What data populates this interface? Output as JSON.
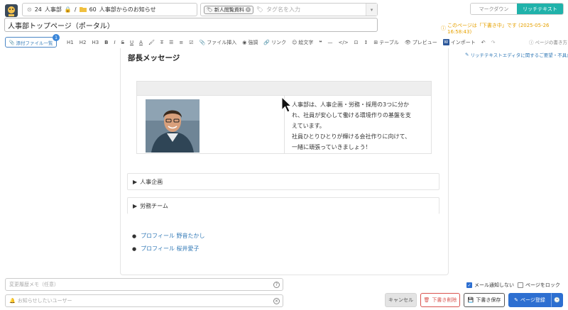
{
  "header": {
    "breadcrumb": {
      "group_id": "24",
      "group_name": "人事部",
      "separator": "/",
      "folder_id": "60",
      "folder_name": "人事部からのお知らせ"
    },
    "tags": {
      "chip_label": "新人閲覧資料",
      "placeholder": "タグ名を入力"
    },
    "mode_toggle": {
      "markdown_label": "マークダウン",
      "richtext_label": "リッチテキスト",
      "active": "richtext"
    }
  },
  "title_input": {
    "value": "人事部トップページ（ポータル）"
  },
  "draft_note": "このページは「下書き中」です (2025-05-26 16:58:43)",
  "toolbar": {
    "attach_label": "添付ファイル一覧",
    "attach_count": "1",
    "h1": "H1",
    "h2": "H2",
    "h3": "H3",
    "file_insert": "ファイル挿入",
    "emphasis": "強調",
    "link": "リンク",
    "emoji": "絵文字",
    "table": "テーブル",
    "preview": "プレビュー",
    "import": "インポート",
    "how_to_write": "ページの書き方",
    "feedback_link": "リッチテキストエディタに関するご要望・不具合"
  },
  "editor": {
    "heading": "部長メッセージ",
    "message_lines": [
      "人事部は、人事企画・労務・採用の3つに分か",
      "れ、社員が安心して働ける環境作りの基盤を支",
      "えています。",
      "社員ひとりひとりが輝ける会社作りに向けて、",
      "一緒に頑張っていきましょう！"
    ],
    "sections": [
      {
        "label": "人事企画"
      },
      {
        "label": "労務チーム"
      }
    ],
    "profiles": [
      {
        "label": "プロフィール 野音たかし"
      },
      {
        "label": "プロフィール 桜井愛子"
      }
    ]
  },
  "footer": {
    "history_memo_placeholder": "変更履歴メモ（任意）",
    "notify_users_placeholder": "お知らせしたいユーザー",
    "no_mail_label": "メール通知しない",
    "no_mail_checked": true,
    "lock_label": "ページをロック",
    "lock_checked": false,
    "cancel_label": "キャンセル",
    "delete_draft_label": "下書き削除",
    "save_draft_label": "下書き保存",
    "register_label": "ページ登録"
  },
  "colors": {
    "accent": "#20b2aa",
    "primary": "#2d6fd1",
    "link": "#337ab7",
    "danger": "#d9534f",
    "warning": "#e6a100"
  }
}
